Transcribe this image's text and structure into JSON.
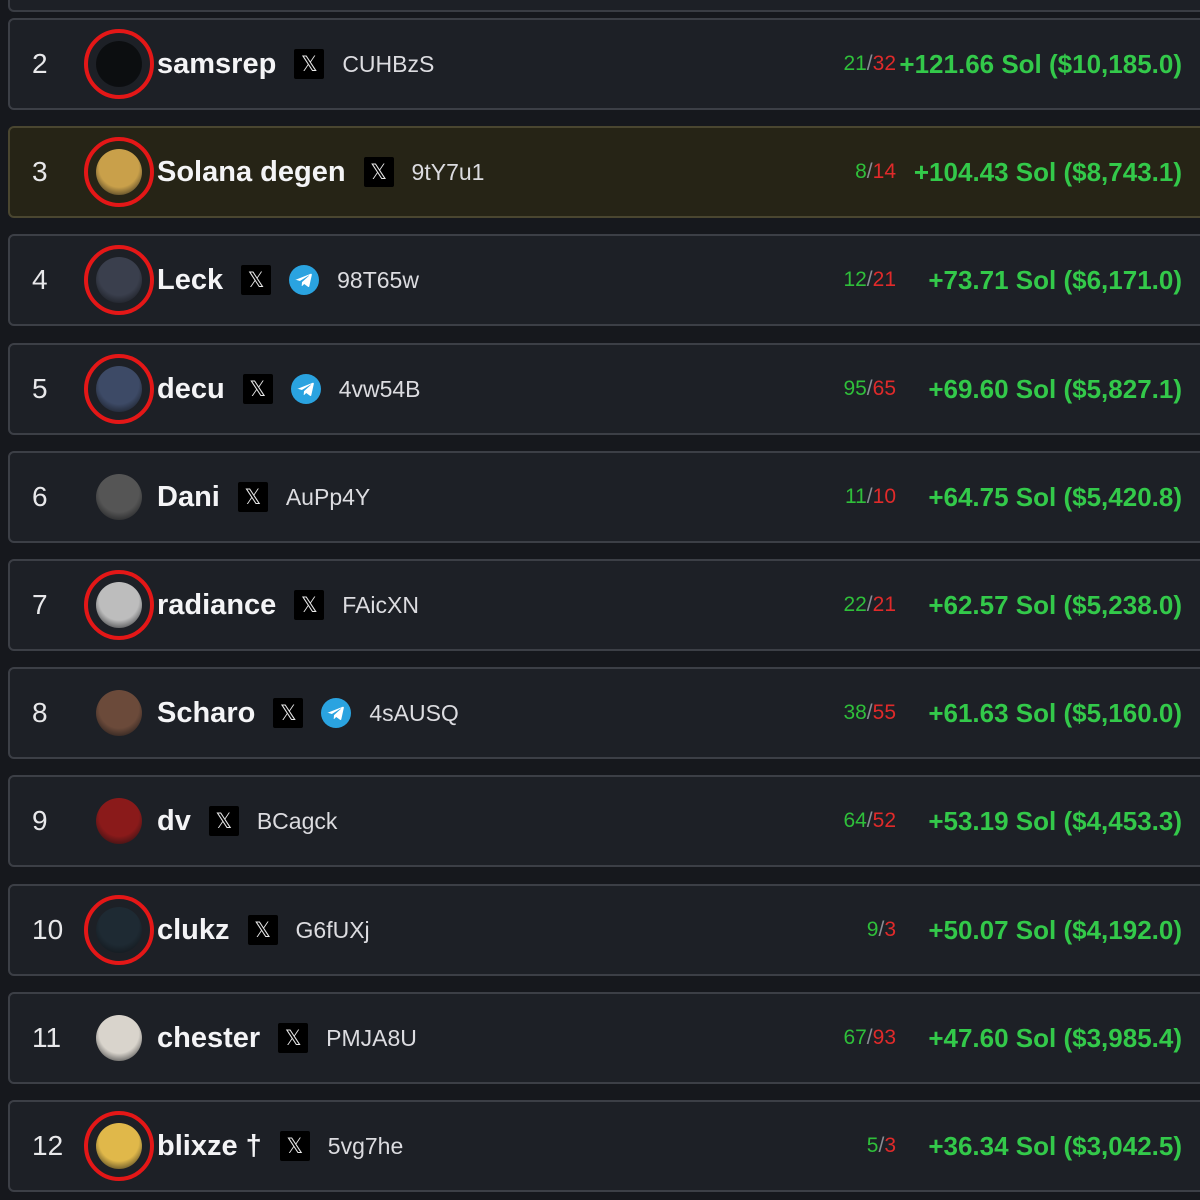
{
  "leaderboard": {
    "rows": [
      {
        "rank": "2",
        "name": "samsrep",
        "wallet": "CUHBzS",
        "wins": "21",
        "losses": "32",
        "pnl": "+121.66 Sol ($10,185.0)",
        "x_icon": "x-logo-icon",
        "telegram": false,
        "circled": true,
        "highlighted": false,
        "avatar_color": "#0c0e10"
      },
      {
        "rank": "3",
        "name": "Solana degen",
        "wallet": "9tY7u1",
        "wins": "8",
        "losses": "14",
        "pnl": "+104.43 Sol ($8,743.1)",
        "x_icon": "x-logo-icon",
        "telegram": false,
        "circled": true,
        "highlighted": true,
        "avatar_color": "#c9a04a"
      },
      {
        "rank": "4",
        "name": "Leck",
        "wallet": "98T65w",
        "wins": "12",
        "losses": "21",
        "pnl": "+73.71 Sol ($6,171.0)",
        "x_icon": "x-logo-icon",
        "telegram": true,
        "circled": true,
        "highlighted": false,
        "avatar_color": "#3a3f4d"
      },
      {
        "rank": "5",
        "name": "decu",
        "wallet": "4vw54B",
        "wins": "95",
        "losses": "65",
        "pnl": "+69.60 Sol ($5,827.1)",
        "x_icon": "x-logo-icon",
        "telegram": true,
        "circled": true,
        "highlighted": false,
        "avatar_color": "#3d4a66"
      },
      {
        "rank": "6",
        "name": "Dani",
        "wallet": "AuPp4Y",
        "wins": "11",
        "losses": "10",
        "pnl": "+64.75 Sol ($5,420.8)",
        "x_icon": "x-logo-icon",
        "telegram": false,
        "circled": false,
        "highlighted": false,
        "avatar_color": "#555"
      },
      {
        "rank": "7",
        "name": "radiance",
        "wallet": "FAicXN",
        "wins": "22",
        "losses": "21",
        "pnl": "+62.57 Sol ($5,238.0)",
        "x_icon": "x-logo-icon",
        "telegram": false,
        "circled": true,
        "highlighted": false,
        "avatar_color": "#bdbdbd"
      },
      {
        "rank": "8",
        "name": "Scharo",
        "wallet": "4sAUSQ",
        "wins": "38",
        "losses": "55",
        "pnl": "+61.63 Sol ($5,160.0)",
        "x_icon": "x-logo-icon",
        "telegram": true,
        "circled": false,
        "highlighted": false,
        "avatar_color": "#6b4a3a"
      },
      {
        "rank": "9",
        "name": "dv",
        "wallet": "BCagck",
        "wins": "64",
        "losses": "52",
        "pnl": "+53.19 Sol ($4,453.3)",
        "x_icon": "x-logo-icon",
        "telegram": false,
        "circled": false,
        "highlighted": false,
        "avatar_color": "#8a1a1a"
      },
      {
        "rank": "10",
        "name": "clukz",
        "wallet": "G6fUXj",
        "wins": "9",
        "losses": "3",
        "pnl": "+50.07 Sol ($4,192.0)",
        "x_icon": "x-logo-icon",
        "telegram": false,
        "circled": true,
        "highlighted": false,
        "avatar_color": "#1e2a33"
      },
      {
        "rank": "11",
        "name": "chester",
        "wallet": "PMJA8U",
        "wins": "67",
        "losses": "93",
        "pnl": "+47.60 Sol ($3,985.4)",
        "x_icon": "x-logo-icon",
        "telegram": false,
        "circled": false,
        "highlighted": false,
        "avatar_color": "#d9d4cc"
      },
      {
        "rank": "12",
        "name": "blixze †",
        "wallet": "5vg7he",
        "wins": "5",
        "losses": "3",
        "pnl": "+36.34 Sol ($3,042.5)",
        "x_icon": "x-logo-icon",
        "telegram": false,
        "circled": true,
        "highlighted": false,
        "avatar_color": "#e0b84a"
      }
    ]
  },
  "colors": {
    "background": "#16181d",
    "row_bg": "#1d2026",
    "highlight_bg": "#262416",
    "wins": "#2fbf3a",
    "losses": "#e02a2a",
    "pnl": "#33c94a",
    "circle": "#e41717",
    "telegram": "#2aa3e0"
  }
}
